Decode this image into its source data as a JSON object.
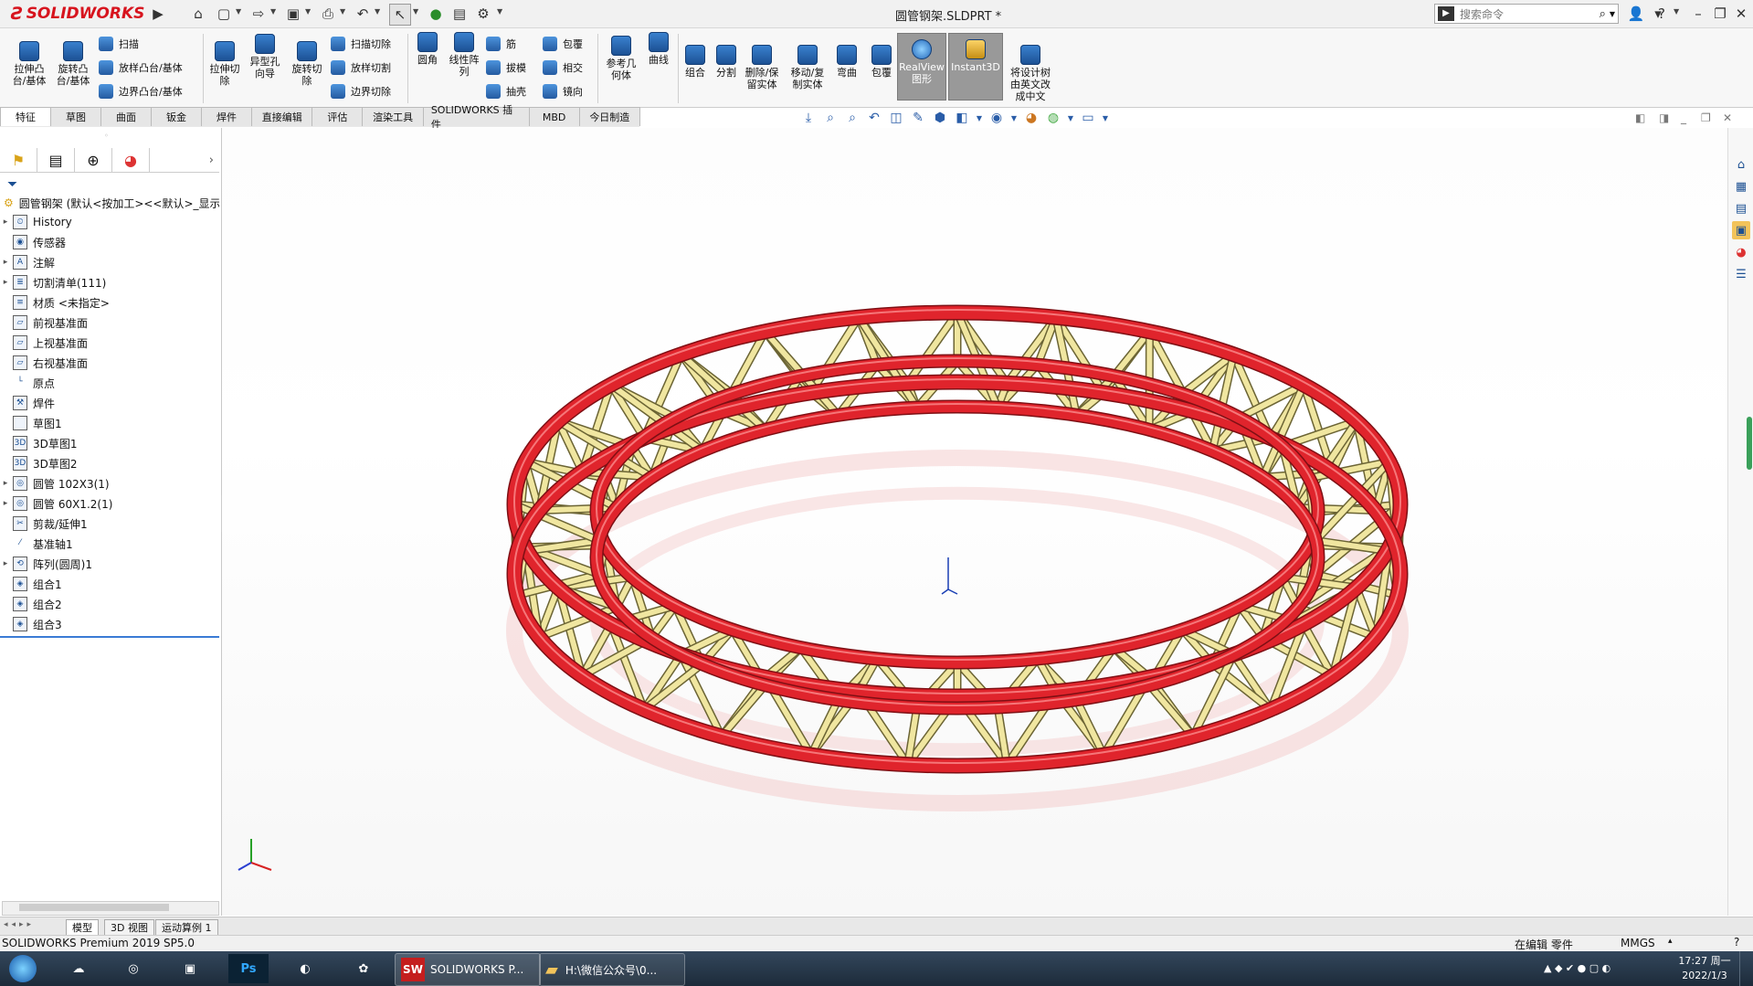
{
  "app": {
    "brand": "SOLIDWORKS",
    "doc_title": "圆管钢架.SLDPRT *",
    "search_placeholder": "搜索命令",
    "version_text": "SOLIDWORKS Premium 2019 SP5.0"
  },
  "ribbon": {
    "extrude_boss": "拉伸凸\n台/基体",
    "revolve_boss": "旋转凸\n台/基体",
    "sweep": "扫描",
    "loft_boss": "放样凸台/基体",
    "boundary_boss": "边界凸台/基体",
    "extrude_cut": "拉伸切\n除",
    "hole_wizard": "异型孔\n向导",
    "revolve_cut": "旋转切\n除",
    "swept_cut": "扫描切除",
    "lofted_cut": "放样切割",
    "boundary_cut": "边界切除",
    "fillet": "圆角",
    "linear_pattern": "线性阵\n列",
    "rib": "筋",
    "draft": "拔模",
    "shell": "抽壳",
    "wrap": "包覆",
    "intersect": "相交",
    "mirror": "镜向",
    "ref_geometry": "参考几\n何体",
    "curves": "曲线",
    "combine": "组合",
    "split": "分割",
    "delete_keep_body": "删除/保\n留实体",
    "move_copy_body": "移动/复\n制实体",
    "flex": "弯曲",
    "wrap2": "包覆",
    "realview": "RealView\n图形",
    "instant3d": "Instant3D",
    "translate_tree": "将设计树\n由英文改\n成中文"
  },
  "tabs": [
    "特征",
    "草图",
    "曲面",
    "钣金",
    "焊件",
    "直接编辑",
    "评估",
    "渲染工具",
    "SOLIDWORKS 插件",
    "MBD",
    "今日制造"
  ],
  "tree": {
    "root": "圆管钢架 (默认<按加工><<默认>_显示",
    "items": [
      {
        "label": "History",
        "expand": true,
        "icon": "history-icon"
      },
      {
        "label": "传感器",
        "expand": false,
        "icon": "sensor-icon"
      },
      {
        "label": "注解",
        "expand": true,
        "icon": "annotation-icon"
      },
      {
        "label": "切割清单(111)",
        "expand": true,
        "icon": "cutlist-icon"
      },
      {
        "label": "材质 <未指定>",
        "expand": false,
        "icon": "material-icon"
      },
      {
        "label": "前视基准面",
        "expand": false,
        "icon": "plane-icon"
      },
      {
        "label": "上视基准面",
        "expand": false,
        "icon": "plane-icon"
      },
      {
        "label": "右视基准面",
        "expand": false,
        "icon": "plane-icon"
      },
      {
        "label": "原点",
        "expand": false,
        "icon": "origin-icon"
      },
      {
        "label": "焊件",
        "expand": false,
        "icon": "weldment-icon"
      },
      {
        "label": "草图1",
        "expand": false,
        "icon": "sketch-icon"
      },
      {
        "label": "3D草图1",
        "expand": false,
        "icon": "3dsketch-icon"
      },
      {
        "label": "3D草图2",
        "expand": false,
        "icon": "3dsketch-icon"
      },
      {
        "label": "圆管 102X3(1)",
        "expand": true,
        "icon": "structural-member-icon"
      },
      {
        "label": "圆管 60X1.2(1)",
        "expand": true,
        "icon": "structural-member-icon"
      },
      {
        "label": "剪裁/延伸1",
        "expand": false,
        "icon": "trim-extend-icon"
      },
      {
        "label": "基准轴1",
        "expand": false,
        "icon": "axis-icon"
      },
      {
        "label": "阵列(圆周)1",
        "expand": true,
        "icon": "circular-pattern-icon"
      },
      {
        "label": "组合1",
        "expand": false,
        "icon": "combine-icon"
      },
      {
        "label": "组合2",
        "expand": false,
        "icon": "combine-icon"
      },
      {
        "label": "组合3",
        "expand": false,
        "icon": "combine-icon"
      }
    ]
  },
  "bottom_tabs": [
    "模型",
    "3D 视图",
    "运动算例 1"
  ],
  "status": {
    "editing": "在编辑 零件",
    "units": "MMGS"
  },
  "taskbar": {
    "tasks": [
      "SOLIDWORKS P...",
      "H:\\微信公众号\\0..."
    ],
    "time": "17:27 周一",
    "date": "2022/1/3"
  },
  "colors": {
    "outer_tube": "#e0242c",
    "brace": "#f0e6a0"
  }
}
